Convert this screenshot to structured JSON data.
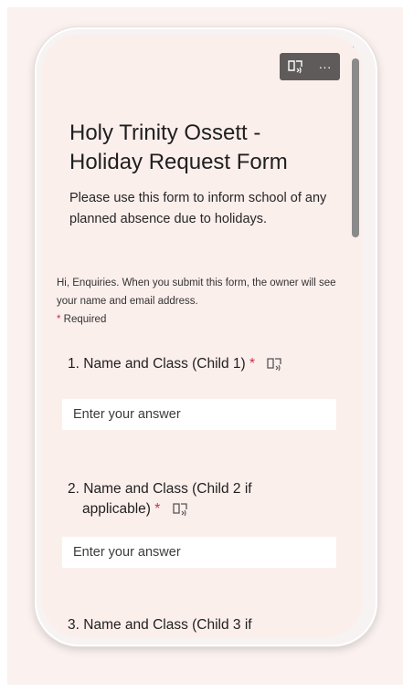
{
  "toolbar": {
    "immersive_reader_icon": "immersive-reader-icon",
    "more_label": "···"
  },
  "form": {
    "title": "Holy Trinity Ossett - Holiday Request Form",
    "description": "Please use this form to inform school of any planned absence due to holidays.",
    "notice": "Hi, Enquiries. When you submit this form, the owner will see your name and email address.",
    "required_marker": "*",
    "required_label": " Required"
  },
  "questions": [
    {
      "number": "1.",
      "label": "Name and Class (Child 1)",
      "required": "*",
      "placeholder": "Enter your answer"
    },
    {
      "number": "2.",
      "label_line1": "Name and Class (Child 2 if",
      "label_line2": "applicable)",
      "required": "*",
      "placeholder": "Enter your answer"
    },
    {
      "number": "3.",
      "label": "Name and Class (Child 3 if"
    }
  ],
  "colors": {
    "background": "#fbefec",
    "accent_required": "#c4314b",
    "toolbar": "#5f5b5a"
  }
}
